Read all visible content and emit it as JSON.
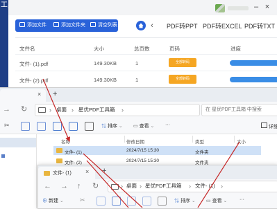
{
  "app": {
    "title": "工具箱",
    "buttons": [
      "添加文件",
      "添加文件夹",
      "清空列表"
    ],
    "tabs": [
      "PDF转PPT",
      "PDF转EXCEL",
      "PDF转TXT"
    ],
    "window_controls": [
      "–",
      "×"
    ],
    "table": {
      "headers": [
        "文件名",
        "大小",
        "总页数",
        "页码",
        "进度"
      ],
      "rows": [
        {
          "name": "文件- (1).pdf",
          "size": "149.30KB",
          "pages": "1",
          "action": "全部转码"
        },
        {
          "name": "文件- (2).pdf",
          "size": "149.30KB",
          "pages": "1",
          "action": "全部转码"
        }
      ]
    }
  },
  "explorer1": {
    "close": "×",
    "new_tab": "+",
    "address": [
      "桌面",
      "星优PDF工具箱"
    ],
    "search_placeholder": "在 星优PDF工具箱 中搜索",
    "toolbar": {
      "sort": "排序",
      "view": "查看",
      "more": "···",
      "details": "详细"
    },
    "columns": [
      "名称",
      "修改日期",
      "类型",
      "大小"
    ],
    "files": [
      {
        "name": "文件- (1)",
        "date": "2024/7/15 15:30",
        "type": "文件夹"
      },
      {
        "name": "文件- (2)",
        "date": "2024/7/15 15:30",
        "type": "文件夹"
      }
    ]
  },
  "explorer2": {
    "tab_title": "文件- (1)",
    "close": "×",
    "new_tab": "+",
    "address": [
      "桌面",
      "星优PDF工具箱",
      "文件- (1)"
    ],
    "toolbar": {
      "new": "新建",
      "sort": "排序",
      "view": "查看",
      "more": "···"
    }
  },
  "colors": {
    "primary": "#2962d9",
    "convert": "#f5a623",
    "progress": "#3a8de6",
    "arrow": "#c62828",
    "folder": "#e9b640"
  }
}
